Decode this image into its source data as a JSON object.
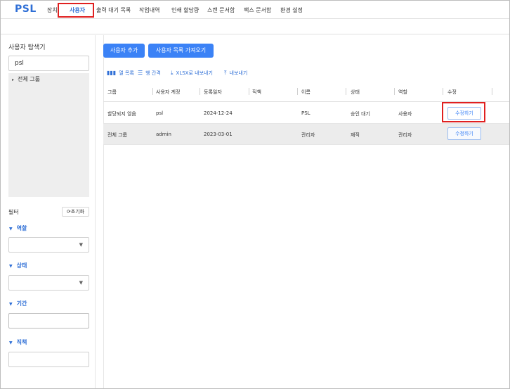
{
  "app": {
    "logo": "PSL"
  },
  "nav": {
    "tabs": [
      {
        "label": "장치"
      },
      {
        "label": "사용자"
      },
      {
        "label": "출력 대기 목록"
      },
      {
        "label": "작업내역"
      },
      {
        "label": "인쇄 할당량"
      },
      {
        "label": "스캔 문서함"
      },
      {
        "label": "팩스 문서함"
      },
      {
        "label": "환경 설정"
      }
    ],
    "active_tab": "사용자"
  },
  "sidebar": {
    "title": "사용자 탐색기",
    "search_value": "psl",
    "tree": [
      {
        "label": "전체 그룹"
      }
    ],
    "filter_label": "필터",
    "reset_label": "초기화",
    "sections": [
      {
        "label": "역할",
        "type": "select",
        "value": ""
      },
      {
        "label": "상태",
        "type": "select",
        "value": ""
      },
      {
        "label": "기간",
        "type": "input",
        "value": ""
      },
      {
        "label": "직책",
        "type": "input",
        "value": ""
      }
    ]
  },
  "main": {
    "buttons": {
      "add_user": "사용자 추가",
      "import_users": "사용자 목록 가져오기"
    },
    "toolbar": {
      "columns": "열 목록",
      "row_spacing": "행 간격",
      "export_xlsx": "XLSX로 내보내기",
      "export": "내보내기"
    },
    "table": {
      "columns": [
        "그룹",
        "사용자 계정",
        "등록일자",
        "직책",
        "이름",
        "상태",
        "역할",
        "수정"
      ],
      "rows": [
        {
          "group": "할당되지 않음",
          "account": "psl",
          "date": "2024-12-24",
          "position": "",
          "name": "PSL",
          "status": "승인 대기",
          "role": "사용자",
          "edit": "수정하기"
        },
        {
          "group": "전체 그룹",
          "account": "admin",
          "date": "2023-03-01",
          "position": "",
          "name": "관리자",
          "status": "재직",
          "role": "관리자",
          "edit": "수정하기"
        }
      ]
    }
  },
  "colors": {
    "accent": "#3b82f6",
    "highlight": "#e02020"
  }
}
